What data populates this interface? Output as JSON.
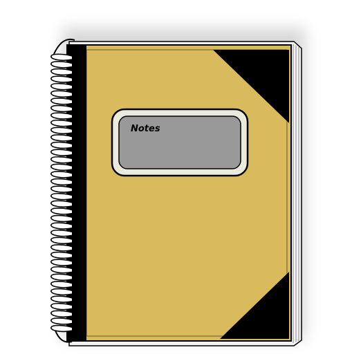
{
  "notebook": {
    "label_text": "Notes",
    "colors": {
      "cover": "#d9bb5e",
      "spine": "#000000",
      "label_outer": "#ebebdd",
      "label_inner": "#999999",
      "pages": "#f2f2f2",
      "shadow": "#d0d0d0",
      "outline": "#000000"
    }
  }
}
